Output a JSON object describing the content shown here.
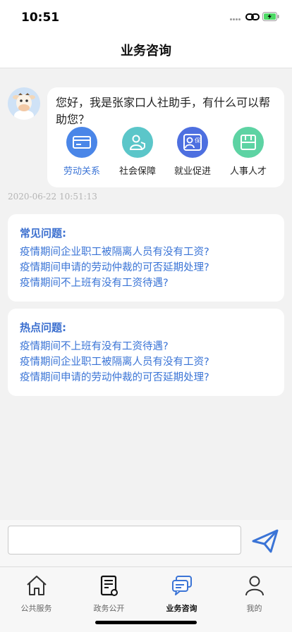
{
  "status_bar": {
    "time": "10:51",
    "battery_color": "#4cd964"
  },
  "nav": {
    "title": "业务咨询"
  },
  "chat": {
    "greeting": "您好，我是张家口人社助手，有什么可以帮助您？",
    "categories": [
      {
        "label": "劳动关系",
        "icon": "card-icon",
        "color": "#4a86e8"
      },
      {
        "label": "社会保障",
        "icon": "person-shield-icon",
        "color": "#5bc6c9"
      },
      {
        "label": "就业促进",
        "icon": "id-badge-icon",
        "color": "#4d6fe0"
      },
      {
        "label": "人事人才",
        "icon": "folder-icon",
        "color": "#5dd3a3"
      }
    ],
    "timestamp": "2020-06-22 10:51:13"
  },
  "faq": {
    "title": "常见问题:",
    "items": [
      "疫情期间企业职工被隔离人员有没有工资?",
      "疫情期间申请的劳动仲裁的可否延期处理?",
      "疫情期间不上班有没有工资待遇?"
    ]
  },
  "hot": {
    "title": "热点问题:",
    "items": [
      "疫情期间不上班有没有工资待遇?",
      "疫情期间企业职工被隔离人员有没有工资?",
      "疫情期间申请的劳动仲裁的可否延期处理?"
    ]
  },
  "input": {
    "placeholder": ""
  },
  "tabs": [
    {
      "label": "公共服务",
      "icon": "home-icon"
    },
    {
      "label": "政务公开",
      "icon": "document-icon"
    },
    {
      "label": "业务咨询",
      "icon": "chat-icon",
      "active": true
    },
    {
      "label": "我的",
      "icon": "user-icon"
    }
  ],
  "accent_color": "#3b74d6"
}
